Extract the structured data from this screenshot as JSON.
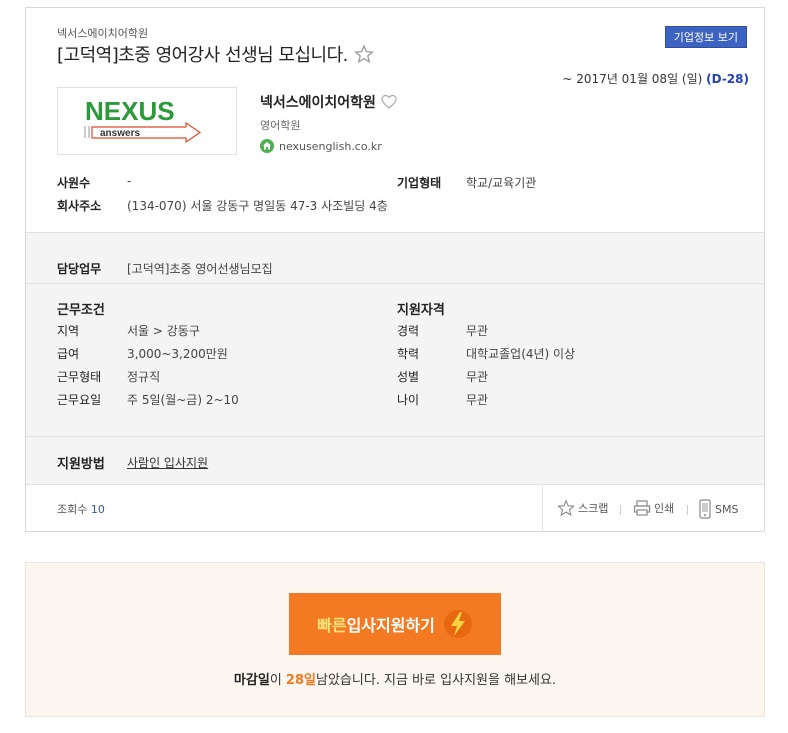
{
  "header": {
    "company_small": "넥서스에이치어학원",
    "title": "[고덕역]초중 영어강사 선생님 모십니다.",
    "company_info_button": "기업정보 보기",
    "deadline_prefix": "~ 2017년 01월 08일 (일)",
    "dday": "(D-28)"
  },
  "company": {
    "logo_text": "NEXUS",
    "logo_sub": "answers",
    "name": "넥서스에이치어학원",
    "industry": "영어학원",
    "homepage": "nexusenglish.co.kr"
  },
  "basic_info": {
    "employees_label": "사원수",
    "employees_value": "-",
    "company_type_label": "기업형태",
    "company_type_value": "학교/교육기관",
    "address_label": "회사주소",
    "address_value": "(134-070) 서울 강동구 명일동 47-3 사조빌딩 4층"
  },
  "duty": {
    "label": "담당업무",
    "value": "[고덕역]초중 영어선생님모집"
  },
  "conditions": {
    "title": "근무조건",
    "rows": [
      {
        "label": "지역",
        "value": "서울 > 강동구"
      },
      {
        "label": "급여",
        "value": "3,000~3,200만원"
      },
      {
        "label": "근무형태",
        "value": "정규직"
      },
      {
        "label": "근무요일",
        "value": "주 5일(월~금) 2~10"
      }
    ]
  },
  "qualifications": {
    "title": "지원자격",
    "rows": [
      {
        "label": "경력",
        "value": "무관"
      },
      {
        "label": "학력",
        "value": "대학교졸업(4년) 이상"
      },
      {
        "label": "성별",
        "value": "무관"
      },
      {
        "label": "나이",
        "value": "무관"
      }
    ]
  },
  "method": {
    "label": "지원방법",
    "value": "사람인 입사지원"
  },
  "footer": {
    "views_label": "조회수",
    "views_count": "10",
    "scrap": "스크랩",
    "print": "인쇄",
    "sms": "SMS"
  },
  "apply": {
    "button_highlight": "빠른",
    "button_rest": "입사지원하기",
    "msg_label": "마감일",
    "msg_particle": "이",
    "msg_days": "28일",
    "msg_rest": "남았습니다. 지금 바로 입사지원을 해보세요."
  },
  "colors": {
    "accent_blue": "#3d63c2",
    "orange": "#f47923"
  }
}
